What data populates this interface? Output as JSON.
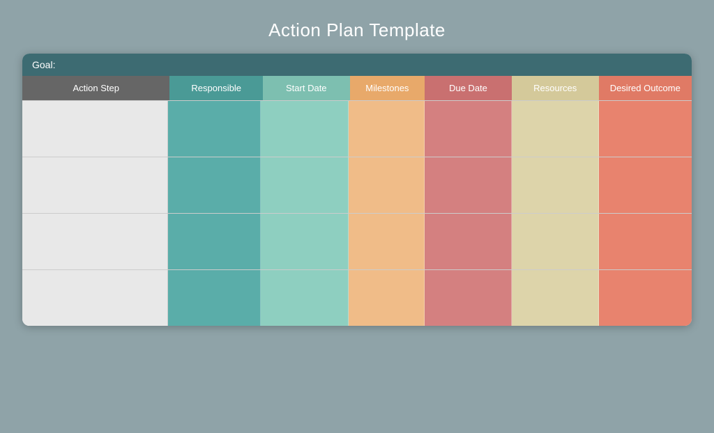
{
  "page": {
    "title": "Action Plan Template"
  },
  "goal": {
    "label": "Goal:"
  },
  "columns": {
    "action_step": "Action Step",
    "responsible": "Responsible",
    "start_date": "Start Date",
    "milestones": "Milestones",
    "due_date": "Due Date",
    "resources": "Resources",
    "desired_outcome": "Desired Outcome"
  },
  "rows": [
    {
      "id": 1
    },
    {
      "id": 2
    },
    {
      "id": 3
    },
    {
      "id": 4
    }
  ]
}
